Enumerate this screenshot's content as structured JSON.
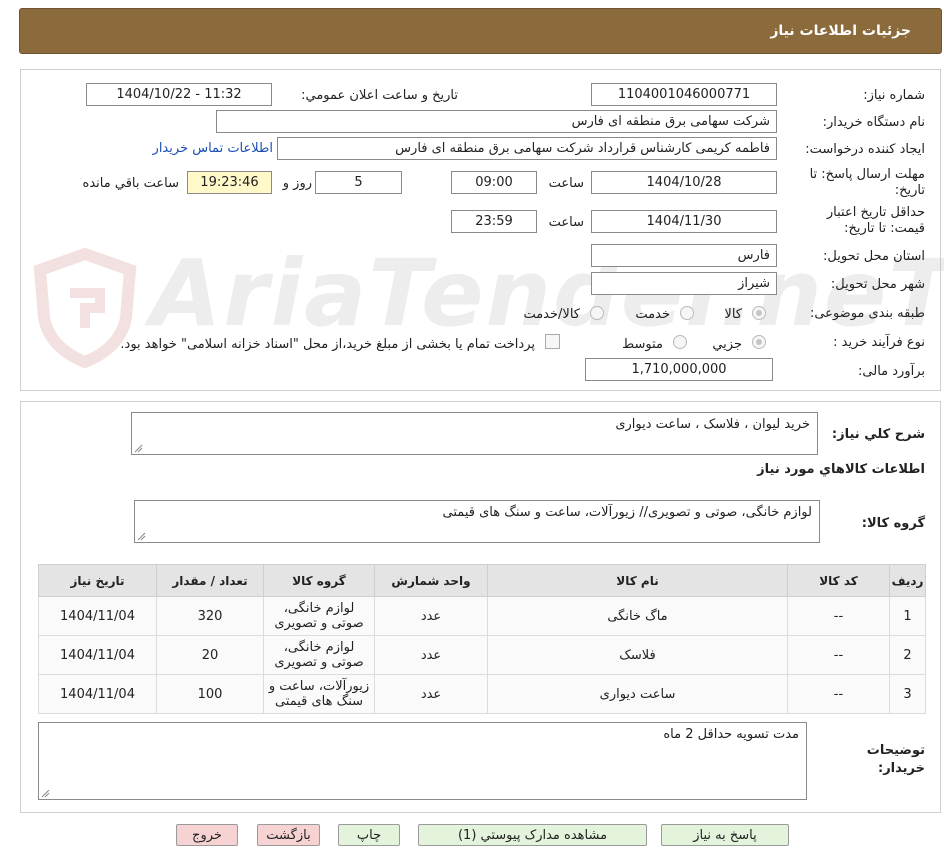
{
  "header": {
    "title": "جزئیات اطلاعات نیاز"
  },
  "watermark": {
    "text": "AriaTender.neT"
  },
  "info": {
    "need_number_label": "شماره نیاز:",
    "need_number": "1104001046000771",
    "announce_label": "تاریخ و ساعت اعلان عمومي:",
    "announce_value": "1404/10/22 - 11:32",
    "buyer_org_label": "نام دستگاه خریدار:",
    "buyer_org": "شرکت سهامی برق منطقه ای فارس",
    "creator_label": "ایجاد کننده درخواست:",
    "creator": "فاطمه کریمی کارشناس قرارداد شرکت سهامی برق منطقه ای فارس",
    "contact_link": "اطلاعات تماس خریدار",
    "deadline_label": "مهلت ارسال پاسخ: تا تاریخ:",
    "deadline_date": "1404/10/28",
    "time_label": "ساعت",
    "deadline_time": "09:00",
    "days_value": "5",
    "days_label": "روز و",
    "remaining_time": "19:23:46",
    "remaining_label": "ساعت باقي مانده",
    "validity_label": "حداقل تاریخ اعتبار قیمت: تا تاریخ:",
    "validity_date": "1404/11/30",
    "validity_time": "23:59",
    "province_label": "استان محل تحویل:",
    "province": "فارس",
    "city_label": "شهر محل تحویل:",
    "city": "شیراز",
    "category_label": "طبقه بندی موضوعی:",
    "category_options": [
      "کالا",
      "خدمت",
      "کالا/خدمت"
    ],
    "process_label": "نوع فرآیند خرید :",
    "process_options": [
      "جزیي",
      "متوسط"
    ],
    "process_note": "پرداخت تمام یا بخشی از مبلغ خرید،از محل \"اسناد خزانه اسلامی\" خواهد بود.",
    "budget_label": "برآورد مالی:",
    "budget": "1,710,000,000"
  },
  "details": {
    "summary_label": "شرح کلي نیاز:",
    "summary": "خرید لیوان ، فلاسک ، ساعت دیواری",
    "items_title": "اطلاعات کالاهاي مورد نیاز",
    "group_label": "گروه کالا:",
    "group_value": "لوازم خانگی، صوتی و تصویری// زیورآلات، ساعت و سنگ های قیمتی",
    "columns": [
      "ردیف",
      "کد کالا",
      "نام کالا",
      "واحد شمارش",
      "گروه کالا",
      "تعداد / مقدار",
      "تاریخ نیاز"
    ],
    "rows": [
      {
        "row": "1",
        "code": "--",
        "name": "ماگ خانگی",
        "unit": "عدد",
        "group": "لوازم خانگی، صوتی و تصویری",
        "qty": "320",
        "date": "1404/11/04"
      },
      {
        "row": "2",
        "code": "--",
        "name": "فلاسک",
        "unit": "عدد",
        "group": "لوازم خانگی، صوتی و تصویری",
        "qty": "20",
        "date": "1404/11/04"
      },
      {
        "row": "3",
        "code": "--",
        "name": "ساعت دیواری",
        "unit": "عدد",
        "group": "زیورآلات، ساعت و سنگ های قیمتی",
        "qty": "100",
        "date": "1404/11/04"
      }
    ],
    "notes_label": "توضیحات خریدار:",
    "notes": "مدت تسویه حداقل 2 ماه"
  },
  "buttons": {
    "reply": "پاسخ به نیاز",
    "attachments": "مشاهده مدارک پیوستي (1)",
    "print": "چاپ",
    "back": "بازگشت",
    "exit": "خروج"
  }
}
